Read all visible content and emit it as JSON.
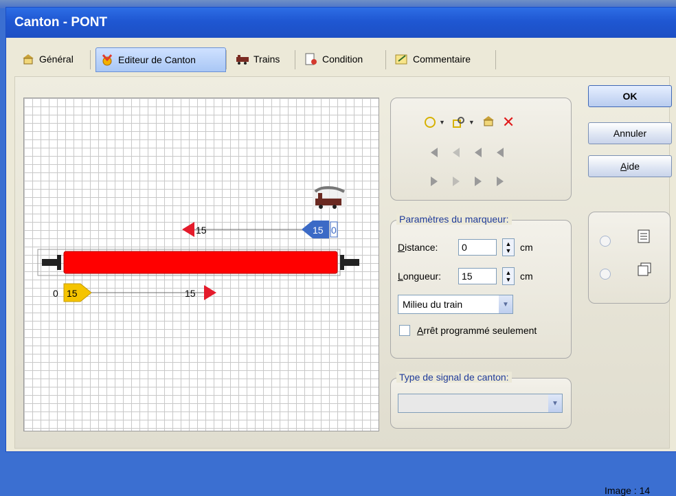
{
  "window": {
    "title": "Canton - PONT"
  },
  "tabs": [
    {
      "label": "Général",
      "icon": "general-icon"
    },
    {
      "label": "Editeur de Canton",
      "icon": "editor-icon"
    },
    {
      "label": "Trains",
      "icon": "trains-icon"
    },
    {
      "label": "Condition",
      "icon": "condition-icon"
    },
    {
      "label": "Commentaire",
      "icon": "comment-icon"
    }
  ],
  "active_tab": "Editeur de Canton",
  "editor": {
    "upper_marker": {
      "left_value": "15",
      "right_value": "15",
      "end_value": "0"
    },
    "lower_marker": {
      "start_value": "0",
      "box_value": "15",
      "end_value": "15"
    },
    "colors": {
      "track": "#ff0000",
      "signal_red": "#e41b2b",
      "marker_blue": "#3b6ac6",
      "marker_yellow": "#f5c400"
    }
  },
  "marker_params": {
    "legend": "Paramètres du marqueur:",
    "distance_label_u": "D",
    "distance_label_rest": "istance:",
    "distance_value": "0",
    "distance_unit": "cm",
    "length_label_u": "L",
    "length_label_rest": "ongueur:",
    "length_value": "15",
    "length_unit": "cm",
    "position_select": "Milieu du train",
    "stop_only_u": "A",
    "stop_only_rest": "rrêt programmé seulement"
  },
  "signal_type": {
    "legend": "Type de signal de canton:",
    "value": ""
  },
  "buttons": {
    "ok": "OK",
    "cancel": "Annuler",
    "help_u": "A",
    "help_rest": "ide"
  },
  "footer": {
    "image_label": "Image : 14"
  }
}
